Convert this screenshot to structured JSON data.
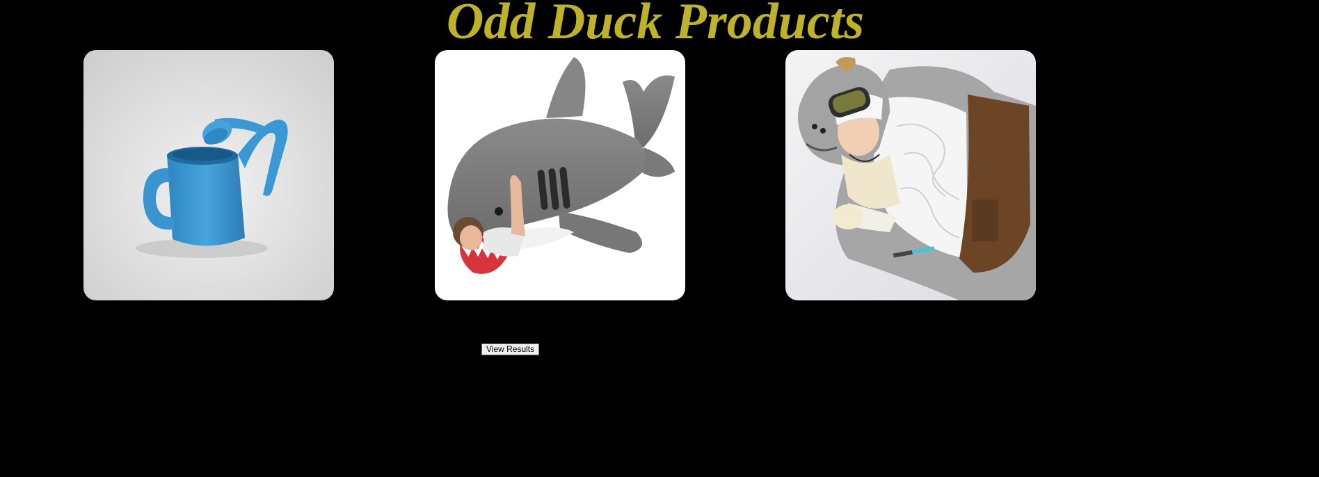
{
  "page": {
    "title": "Odd Duck Products",
    "title_color": "#bdb22a",
    "background": "#000000"
  },
  "products": [
    {
      "name": "watering-can",
      "icon": "watering-can-image"
    },
    {
      "name": "shark-sleeping-bag",
      "icon": "shark-sleeping-bag-image"
    },
    {
      "name": "tauntaun-sleeping-bag",
      "icon": "tauntaun-sleeping-bag-image"
    }
  ],
  "controls": {
    "view_results_label": "View Results"
  }
}
